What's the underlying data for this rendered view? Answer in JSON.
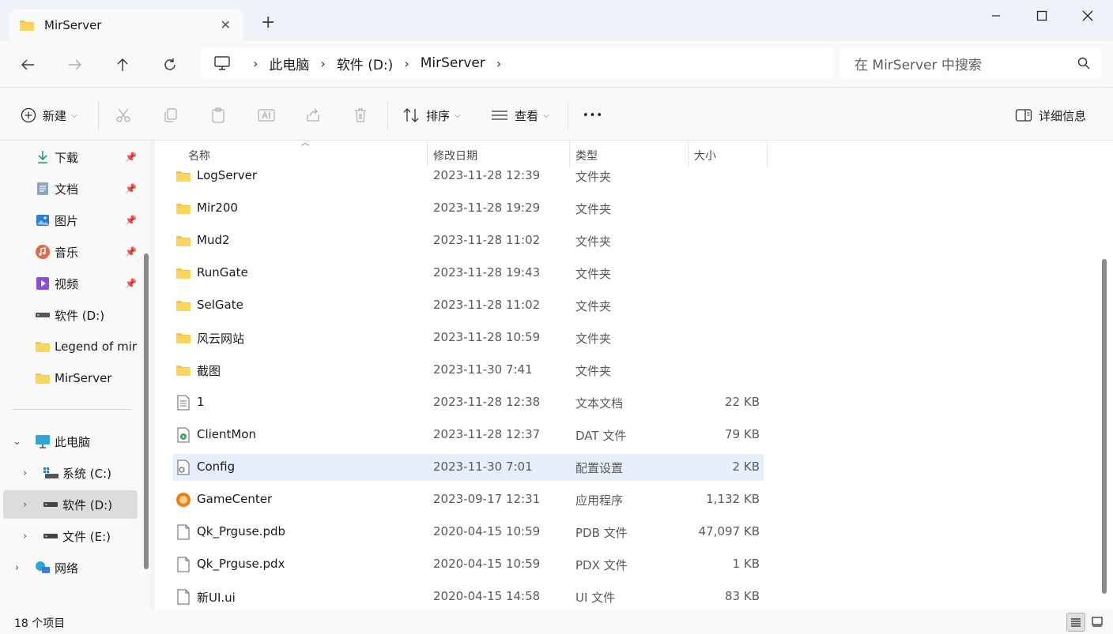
{
  "window": {
    "tab_title": "MirServer",
    "close_tab_glyph": "✕",
    "new_tab_glyph": "+"
  },
  "nav": {
    "breadcrumb": [
      "此电脑",
      "软件 (D:)",
      "MirServer"
    ],
    "search_placeholder": "在 MirServer 中搜索"
  },
  "toolbar": {
    "new_label": "新建",
    "sort_label": "排序",
    "view_label": "查看",
    "more_glyph": "•••",
    "details_label": "详细信息"
  },
  "sidebar": {
    "quick_access": [
      {
        "label": "下载",
        "icon": "download-icon",
        "pinned": true
      },
      {
        "label": "文档",
        "icon": "documents-icon",
        "pinned": true
      },
      {
        "label": "图片",
        "icon": "pictures-icon",
        "pinned": true
      },
      {
        "label": "音乐",
        "icon": "music-icon",
        "pinned": true
      },
      {
        "label": "视频",
        "icon": "videos-icon",
        "pinned": true
      },
      {
        "label": "软件 (D:)",
        "icon": "drive-icon",
        "pinned": false
      },
      {
        "label": "Legend of mir",
        "icon": "folder-icon",
        "pinned": false
      },
      {
        "label": "MirServer",
        "icon": "folder-icon",
        "pinned": false
      }
    ],
    "this_pc": {
      "label": "此电脑",
      "icon": "computer-icon",
      "expanded": true
    },
    "drives": [
      {
        "label": "系统 (C:)",
        "icon": "system-drive-icon",
        "selected": false
      },
      {
        "label": "软件 (D:)",
        "icon": "drive-icon",
        "selected": true
      },
      {
        "label": "文件 (E:)",
        "icon": "drive-icon",
        "selected": false
      }
    ],
    "network": {
      "label": "网络",
      "icon": "network-icon"
    }
  },
  "file_list": {
    "columns": [
      "名称",
      "修改日期",
      "类型",
      "大小"
    ],
    "rows": [
      {
        "name": "LogServer",
        "date": "2023-11-28 12:39",
        "type": "文件夹",
        "size": "",
        "icon": "folder-icon"
      },
      {
        "name": "Mir200",
        "date": "2023-11-28 19:29",
        "type": "文件夹",
        "size": "",
        "icon": "folder-icon"
      },
      {
        "name": "Mud2",
        "date": "2023-11-28 11:02",
        "type": "文件夹",
        "size": "",
        "icon": "folder-icon"
      },
      {
        "name": "RunGate",
        "date": "2023-11-28 19:43",
        "type": "文件夹",
        "size": "",
        "icon": "folder-icon"
      },
      {
        "name": "SelGate",
        "date": "2023-11-28 11:02",
        "type": "文件夹",
        "size": "",
        "icon": "folder-icon"
      },
      {
        "name": "风云网站",
        "date": "2023-11-28 10:59",
        "type": "文件夹",
        "size": "",
        "icon": "folder-icon"
      },
      {
        "name": "截图",
        "date": "2023-11-30 7:41",
        "type": "文件夹",
        "size": "",
        "icon": "folder-icon"
      },
      {
        "name": "1",
        "date": "2023-11-28 12:38",
        "type": "文本文档",
        "size": "22 KB",
        "icon": "text-file-icon"
      },
      {
        "name": "ClientMon",
        "date": "2023-11-28 12:37",
        "type": "DAT 文件",
        "size": "79 KB",
        "icon": "media-file-icon"
      },
      {
        "name": "Config",
        "date": "2023-11-30 7:01",
        "type": "配置设置",
        "size": "2 KB",
        "icon": "config-file-icon",
        "selected": true
      },
      {
        "name": "GameCenter",
        "date": "2023-09-17 12:31",
        "type": "应用程序",
        "size": "1,132 KB",
        "icon": "app-icon"
      },
      {
        "name": "Qk_Prguse.pdb",
        "date": "2020-04-15 10:59",
        "type": "PDB 文件",
        "size": "47,097 KB",
        "icon": "file-icon"
      },
      {
        "name": "Qk_Prguse.pdx",
        "date": "2020-04-15 10:59",
        "type": "PDX 文件",
        "size": "1 KB",
        "icon": "file-icon"
      },
      {
        "name": "新UI.ui",
        "date": "2020-04-15 14:58",
        "type": "UI 文件",
        "size": "83 KB",
        "icon": "file-icon"
      }
    ]
  },
  "status": {
    "item_count": "18 个项目"
  },
  "colors": {
    "accent": "#0067c0",
    "folder": "#f8c640",
    "selected_row": "#e5f0fb"
  }
}
